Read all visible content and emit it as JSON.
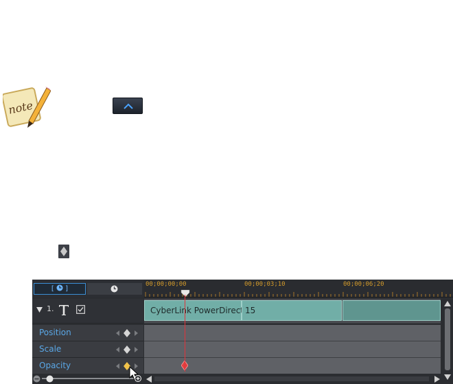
{
  "editor": {
    "ruler": {
      "timecodes": [
        "00;00;00;00",
        "00;00;03;10",
        "00;00;06;20"
      ]
    },
    "track": {
      "number": "1.",
      "clip_label": "CyberLink PowerDirector",
      "clip_label_2": "15"
    },
    "attributes": [
      {
        "label": "Position"
      },
      {
        "label": "Scale"
      },
      {
        "label": "Opacity"
      }
    ]
  },
  "colors": {
    "accent": "#3b8fd6",
    "timecode": "#d49b2a",
    "playhead": "#e2333a",
    "clip": "#71aea7",
    "keyframe_active": "#f0c24a"
  }
}
